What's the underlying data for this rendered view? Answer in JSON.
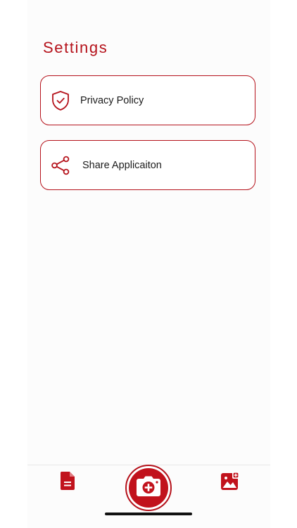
{
  "header": {
    "title": "Settings"
  },
  "settings": {
    "items": [
      {
        "label": "Privacy Policy",
        "icon": "shield-check-icon"
      },
      {
        "label": "Share Applicaiton",
        "icon": "share-icon"
      }
    ]
  },
  "bottom_nav": {
    "items": [
      {
        "icon": "document-icon"
      },
      {
        "icon": "camera-plus-icon"
      },
      {
        "icon": "gallery-add-icon"
      }
    ]
  },
  "colors": {
    "accent": "#b5121b",
    "text": "#1b1b1b",
    "background": "#ffffff"
  }
}
